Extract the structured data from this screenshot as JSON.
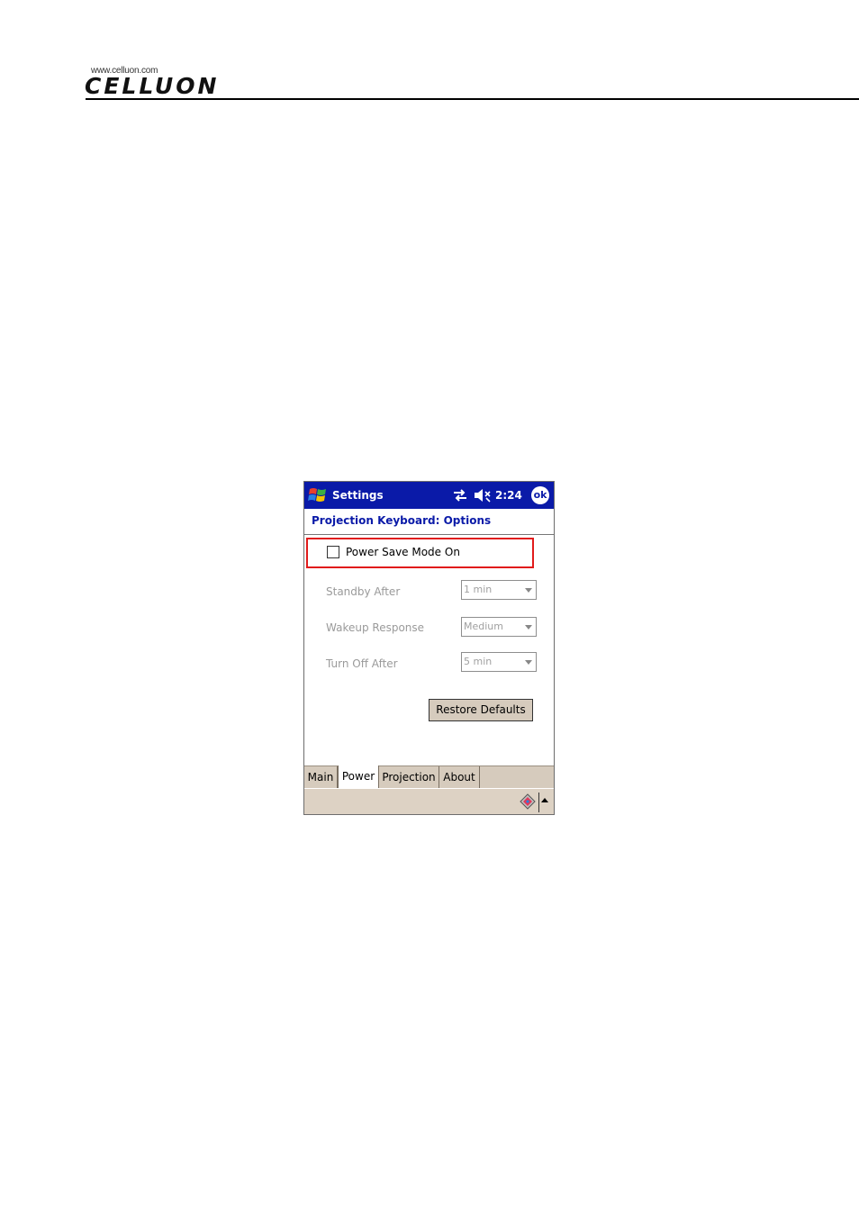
{
  "logo": {
    "url_text": "www.celluon.com",
    "wordmark": "CELLUON"
  },
  "device": {
    "title": "Settings",
    "time": "2:24",
    "ok_label": "ok",
    "heading": "Projection Keyboard: Options",
    "power_save": {
      "label": "Power Save Mode On",
      "checked": false
    },
    "fields": [
      {
        "label": "Standby After",
        "value": "1 min"
      },
      {
        "label": "Wakeup Response",
        "value": "Medium"
      },
      {
        "label": "Turn Off After",
        "value": "5 min"
      }
    ],
    "restore_label": "Restore Defaults",
    "tabs": [
      {
        "label": "Main",
        "active": false
      },
      {
        "label": "Power",
        "active": true
      },
      {
        "label": "Projection",
        "active": false
      },
      {
        "label": "About",
        "active": false
      }
    ],
    "icons": [
      "windows-start-icon",
      "sync-icon",
      "volume-mute-icon",
      "keyboard-icon",
      "arrow-up-icon"
    ],
    "colors": {
      "titlebar": "#0a1aa8",
      "highlight": "#e11b1b",
      "tab_bg": "#d6cbbd"
    }
  }
}
